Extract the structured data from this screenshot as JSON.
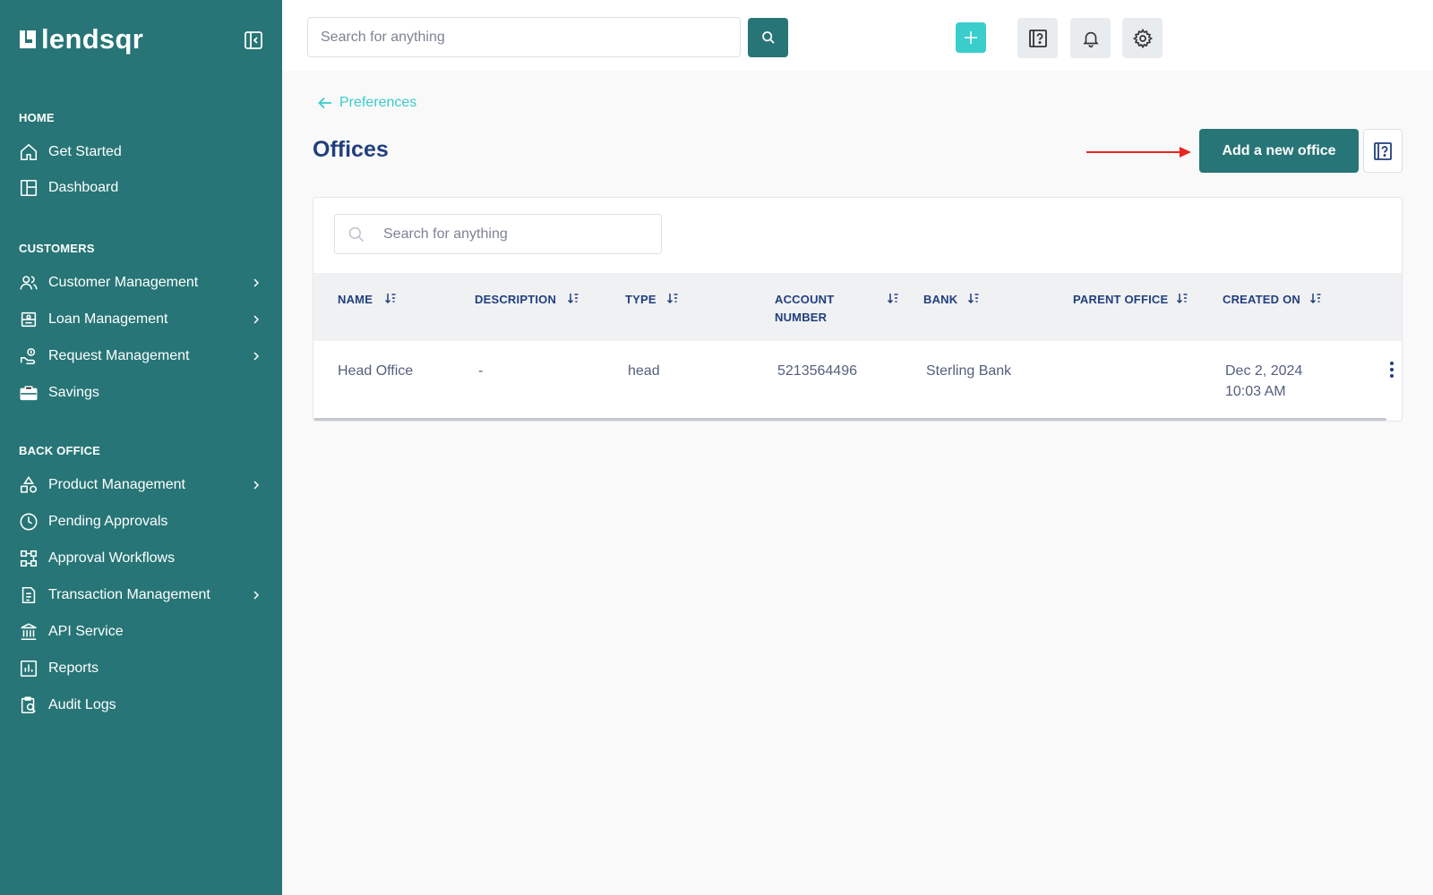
{
  "brand": {
    "name": "lendsqr"
  },
  "sidebar": {
    "sections": [
      {
        "title": "HOME",
        "items": [
          {
            "label": "Get Started",
            "icon": "home-icon",
            "chevron": false
          },
          {
            "label": "Dashboard",
            "icon": "dashboard-icon",
            "chevron": false
          }
        ]
      },
      {
        "title": "CUSTOMERS",
        "items": [
          {
            "label": "Customer Management",
            "icon": "users-icon",
            "chevron": true
          },
          {
            "label": "Loan Management",
            "icon": "loan-icon",
            "chevron": true
          },
          {
            "label": "Request Management",
            "icon": "request-icon",
            "chevron": true
          },
          {
            "label": "Savings",
            "icon": "briefcase-icon",
            "chevron": false
          }
        ]
      },
      {
        "title": "BACK OFFICE",
        "items": [
          {
            "label": "Product Management",
            "icon": "shapes-icon",
            "chevron": true
          },
          {
            "label": "Pending Approvals",
            "icon": "clock-icon",
            "chevron": false
          },
          {
            "label": "Approval Workflows",
            "icon": "workflow-icon",
            "chevron": false
          },
          {
            "label": "Transaction Management",
            "icon": "transaction-icon",
            "chevron": true
          },
          {
            "label": "API Service",
            "icon": "bank-icon",
            "chevron": false
          },
          {
            "label": "Reports",
            "icon": "chart-icon",
            "chevron": false
          },
          {
            "label": "Audit Logs",
            "icon": "audit-icon",
            "chevron": false
          }
        ]
      }
    ]
  },
  "topbar": {
    "search_placeholder": "Search for anything"
  },
  "main": {
    "back_label": "Preferences",
    "title": "Offices",
    "add_button_label": "Add a new office",
    "table_search_placeholder": "Search for anything",
    "columns": [
      {
        "line1": "NAME",
        "line2": ""
      },
      {
        "line1": "DESCRIPTION",
        "line2": ""
      },
      {
        "line1": "TYPE",
        "line2": ""
      },
      {
        "line1": "ACCOUNT",
        "line2": "NUMBER"
      },
      {
        "line1": "BANK",
        "line2": ""
      },
      {
        "line1": "PARENT OFFICE",
        "line2": ""
      },
      {
        "line1": "CREATED ON",
        "line2": ""
      }
    ],
    "rows": [
      {
        "name": "Head Office",
        "description": "-",
        "type": "head",
        "account_number": "5213564496",
        "bank": "Sterling Bank",
        "parent_office": "",
        "created_on_date": "Dec 2, 2024",
        "created_on_time": "10:03 AM"
      }
    ]
  },
  "colors": {
    "sidebar_bg": "#277576",
    "accent": "#39cdcc",
    "title": "#213f7d",
    "annotation_arrow": "#e8261f"
  }
}
